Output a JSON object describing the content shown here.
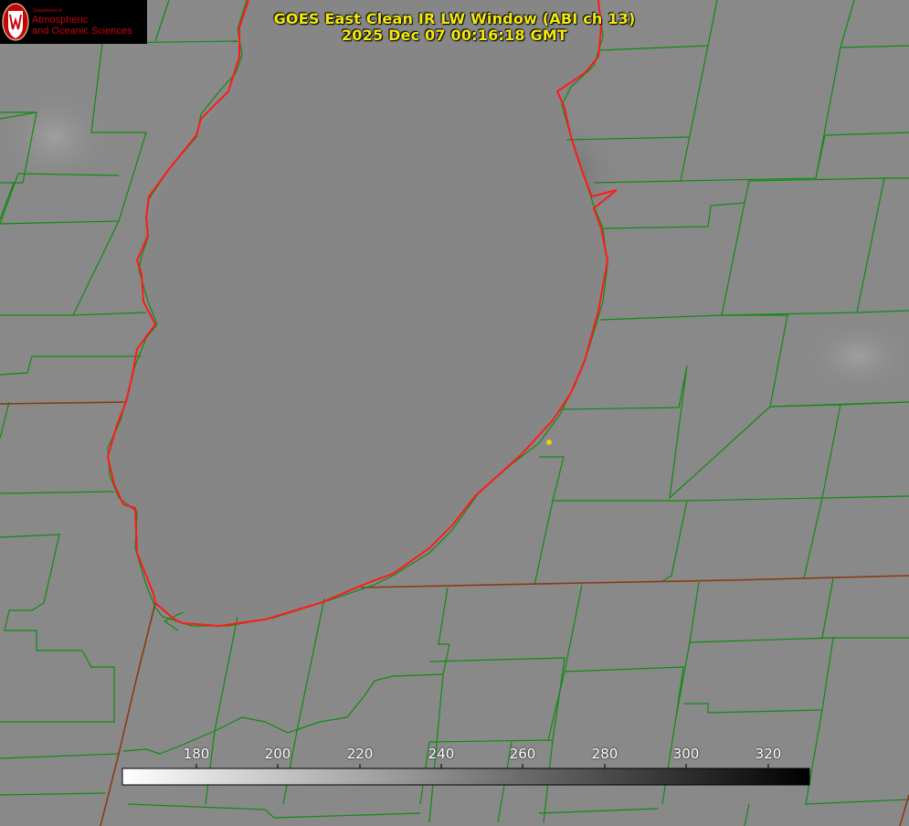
{
  "title": {
    "line1": "GOES East Clean IR LW Window (ABI ch 13)",
    "line2": "2025 Dec 07 00:16:18 GMT"
  },
  "logo": {
    "small": "Department of",
    "line1": "Atmospheric",
    "line2": "and Oceanic Sciences"
  },
  "colorbar": {
    "ticks": [
      "180",
      "200",
      "220",
      "240",
      "260",
      "280",
      "300",
      "320"
    ],
    "range": [
      162,
      330
    ],
    "gradient": [
      "#ffffff",
      "#000000"
    ]
  },
  "colors": {
    "background": "#8a8a8a",
    "coastline": "#ff1a1a",
    "county_lines": "#118a11",
    "state_lines": "#8a3a12",
    "title": "#f3e90e",
    "marker": "#e8d20a"
  }
}
